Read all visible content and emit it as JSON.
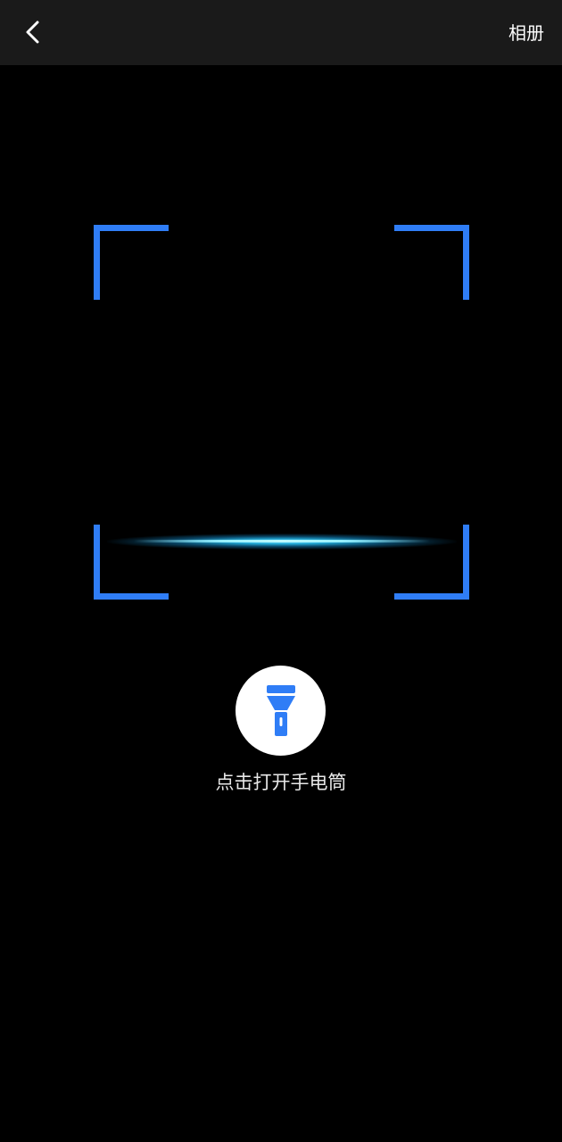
{
  "header": {
    "back_icon": "chevron-left-icon",
    "album_label": "相册",
    "background_color": "#1a1a1a"
  },
  "scanner": {
    "frame_color": "#2f7df6",
    "scan_line_color": "#3cc8ff"
  },
  "flashlight": {
    "icon": "flashlight-icon",
    "icon_color": "#2f7df6",
    "label": "点击打开手电筒"
  }
}
